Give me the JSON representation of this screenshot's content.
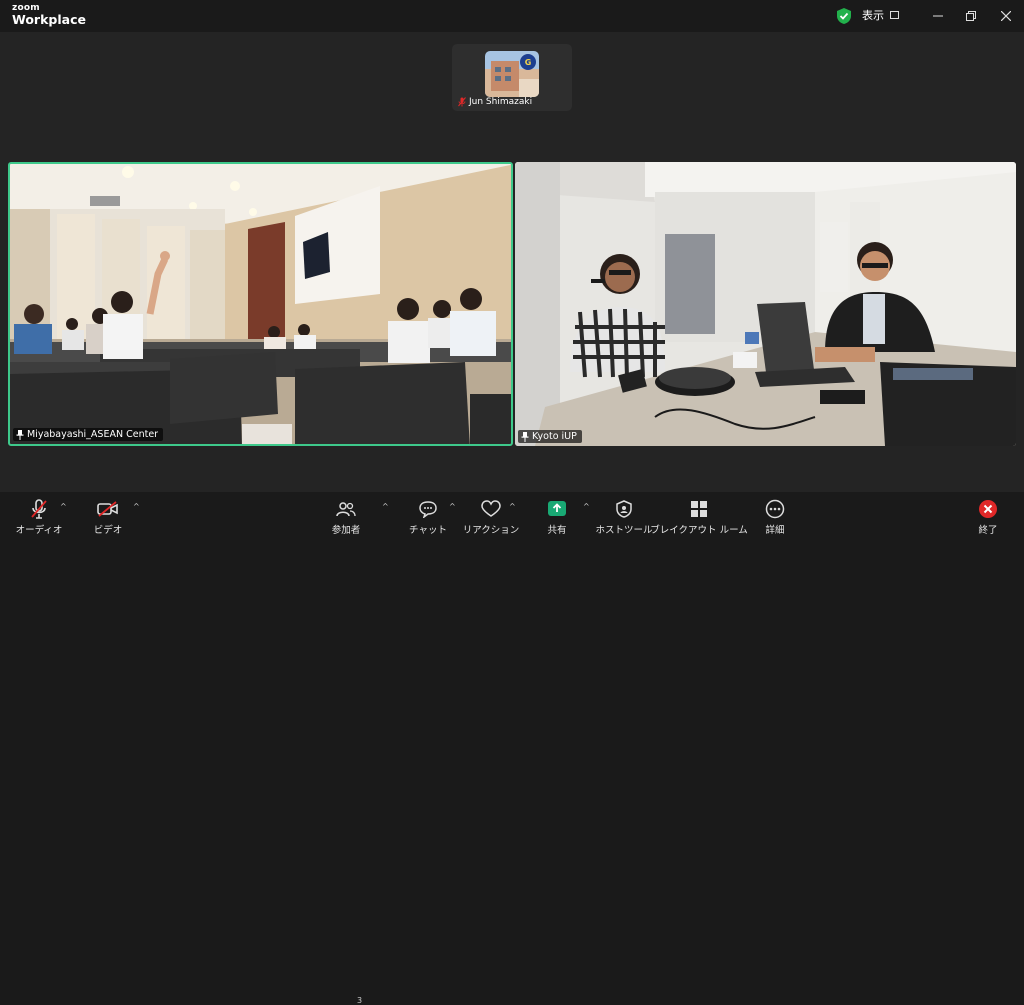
{
  "app": {
    "brand_small": "zoom",
    "brand_large": "Workplace"
  },
  "titlebar": {
    "view_label": "表示"
  },
  "participants": {
    "thumbnail": {
      "name": "Jun Shimazaki"
    },
    "tiles": [
      {
        "name": "Miyabayashi_ASEAN Center",
        "active_speaker": true
      },
      {
        "name": "Kyoto iUP",
        "active_speaker": false
      }
    ]
  },
  "toolbar": {
    "audio": "オーディオ",
    "video": "ビデオ",
    "participants": "参加者",
    "participants_count": "3",
    "chat": "チャット",
    "reactions": "リアクション",
    "share": "共有",
    "host_tools": "ホストツール",
    "breakout": "ブレイクアウト ルーム",
    "more": "詳細",
    "end": "終了"
  },
  "colors": {
    "active_border": "#3ec98b",
    "share_green": "#19a974",
    "end_red": "#e02828",
    "mute_red": "#e02828"
  }
}
